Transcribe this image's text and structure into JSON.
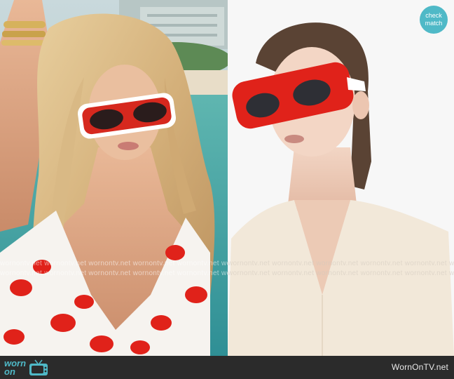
{
  "badge": {
    "line1": "check",
    "line2": "match",
    "color": "#4fb9c7"
  },
  "watermark": {
    "row1": "wornontv.net   wornontv.net   wornontv.net   wornontv.net   wornontv.net   wornontv.net   wornontv.net",
    "row2": "wornontv.net   wornontv.net   wornontv.net   wornontv.net   wornontv.net   wornontv.net   wornontv.net"
  },
  "footer": {
    "logo_word1": "worn",
    "logo_word2": "on",
    "logo_icon": "tv-icon",
    "site_name": "WornOnTV.net",
    "logo_color": "#4fb9c7",
    "bg": "#2b2b2b"
  },
  "colors": {
    "accent": "#e0221a",
    "frame_white": "#ffffff"
  }
}
